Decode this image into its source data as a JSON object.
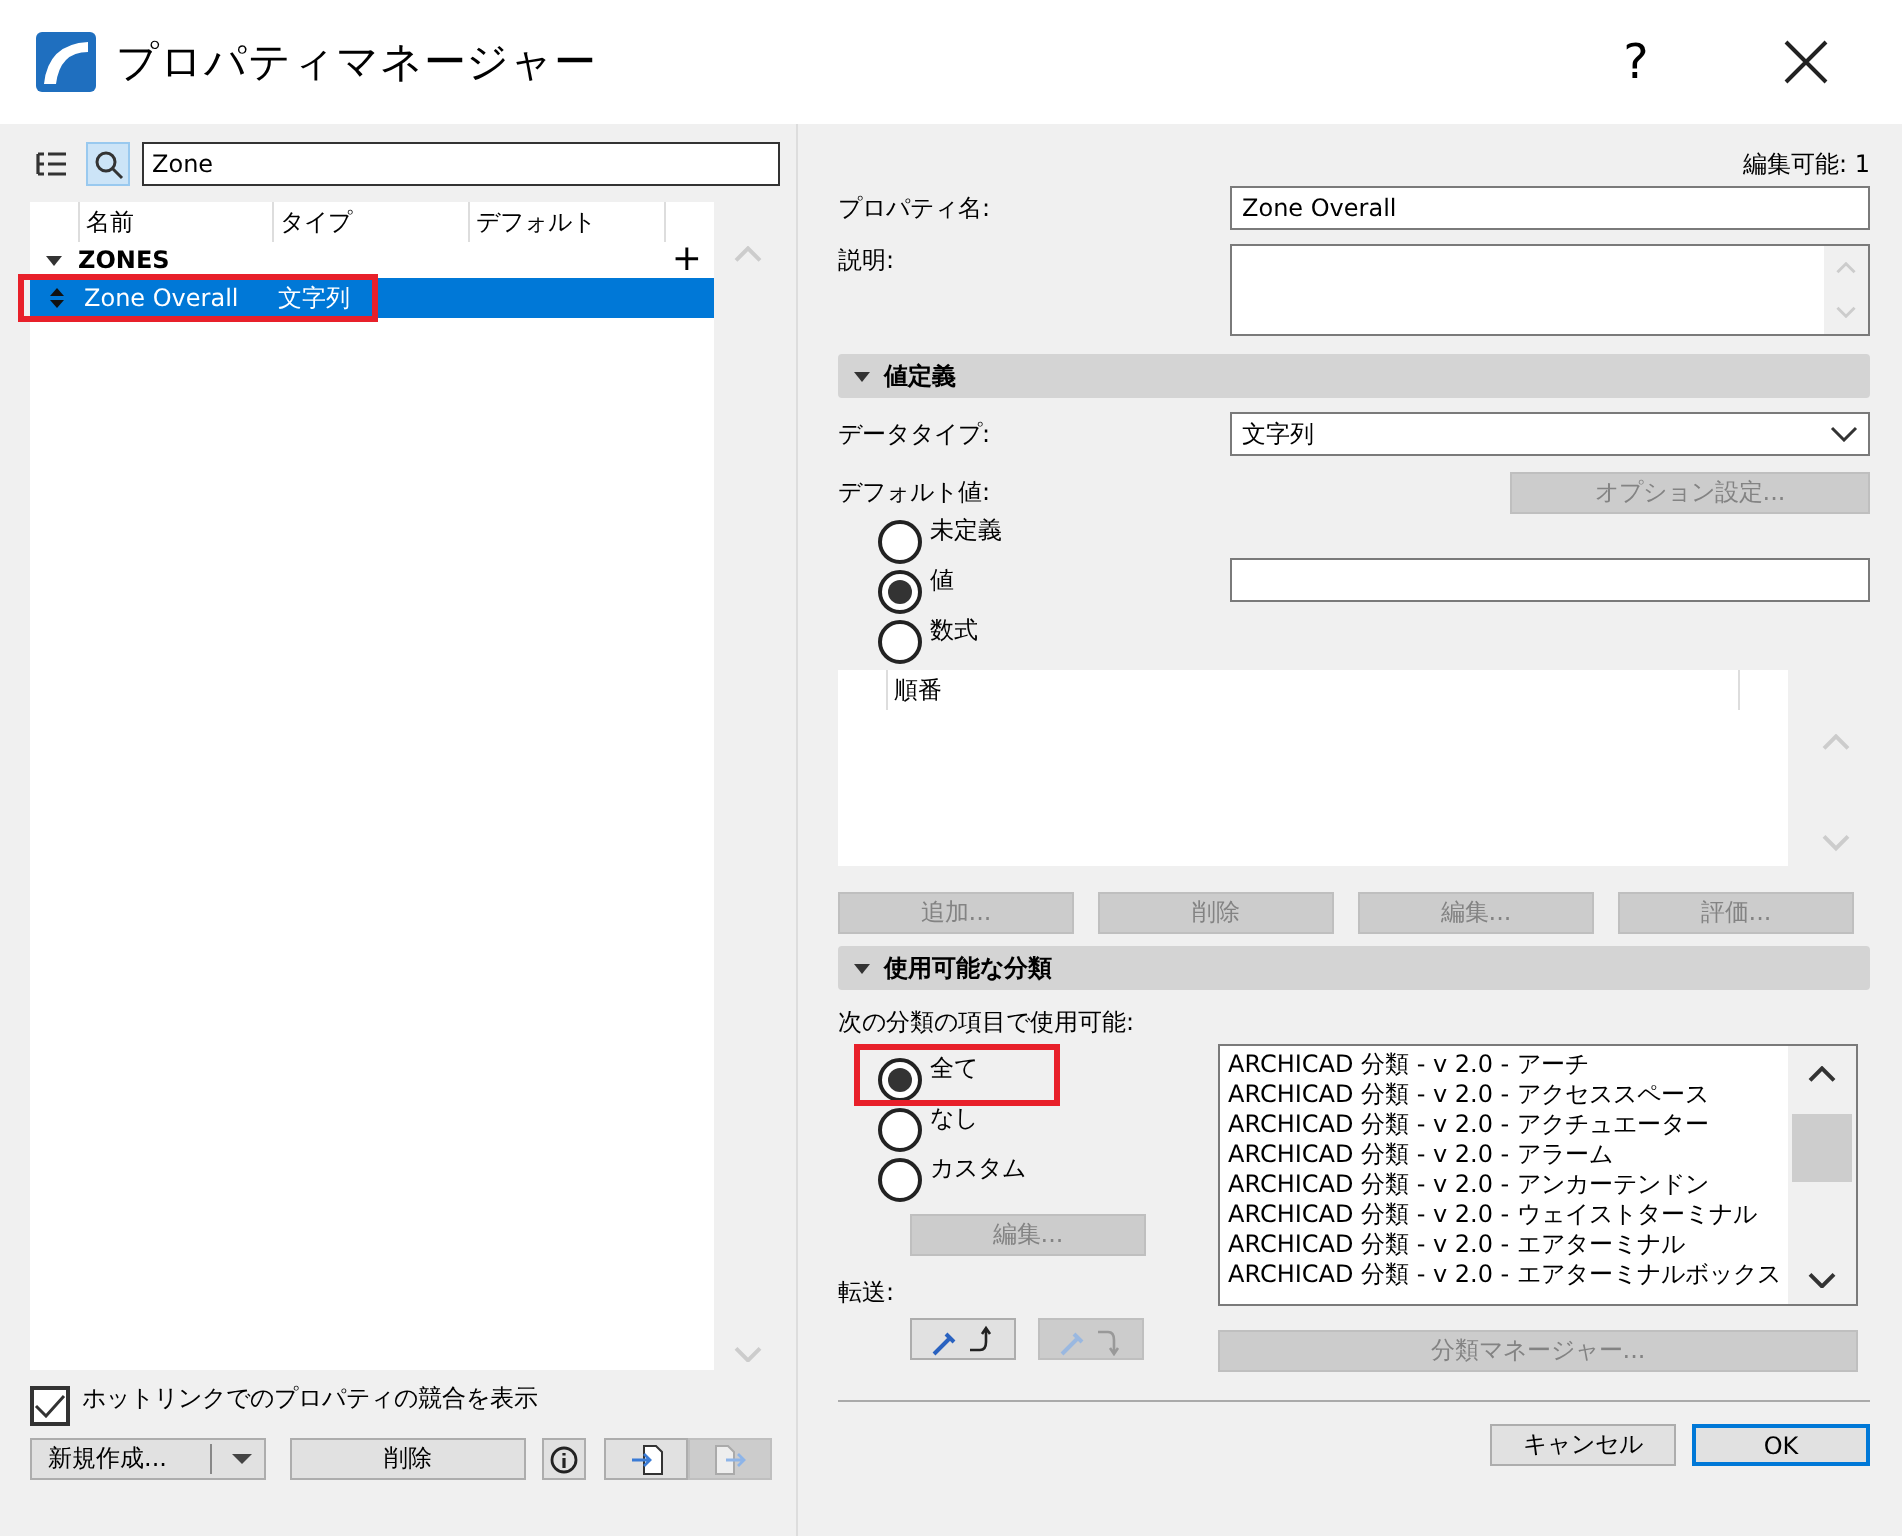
{
  "window": {
    "title": "プロパティマネージャー",
    "help": "?"
  },
  "left": {
    "search": {
      "value": "Zone"
    },
    "columns": [
      "名前",
      "タイプ",
      "デフォルト"
    ],
    "groups": [
      {
        "name": "ZONES",
        "expanded": true,
        "add": "+",
        "children": [
          {
            "name": "Zone Overall",
            "type": "文字列",
            "selected": true,
            "highlighted": true
          }
        ]
      }
    ],
    "hotlink": {
      "label": "ホットリンクでのプロパティの競合を表示",
      "checked": true
    },
    "new_button": "新規作成...",
    "delete_button": "削除"
  },
  "right": {
    "editable": "編集可能: 1",
    "name": {
      "label": "プロパティ名:",
      "value": "Zone Overall"
    },
    "description": {
      "label": "説明:"
    },
    "value_section": {
      "title": "値定義",
      "expanded": true
    },
    "data_type": {
      "label": "データタイプ:",
      "value": "文字列"
    },
    "default": {
      "label": "デフォルト値:",
      "options_button": "オプション設定...",
      "options_disabled": true
    },
    "default_options": [
      {
        "label": "未定義",
        "selected": false
      },
      {
        "label": "値",
        "selected": true
      },
      {
        "label": "数式",
        "selected": false
      }
    ],
    "expression_header": "順番",
    "expression_buttons": [
      {
        "label": "追加...",
        "disabled": true
      },
      {
        "label": "削除",
        "disabled": true
      },
      {
        "label": "編集...",
        "disabled": true
      },
      {
        "label": "評価...",
        "disabled": true
      }
    ],
    "class_section": {
      "title": "使用可能な分類",
      "expanded": true
    },
    "available_label": "次の分類の項目で使用可能:",
    "class_options": [
      {
        "label": "全て",
        "selected": true,
        "highlighted": true
      },
      {
        "label": "なし",
        "selected": false,
        "highlighted": false
      },
      {
        "label": "カスタム",
        "selected": false,
        "highlighted": false
      }
    ],
    "edit_button": {
      "label": "編集...",
      "disabled": true
    },
    "transfer_label": "転送:",
    "transfer_buttons": [
      {
        "kind": "pick",
        "disabled": false
      },
      {
        "kind": "inject",
        "disabled": true
      }
    ],
    "classes": [
      "ARCHICAD 分類 - v 2.0 - アーチ",
      "ARCHICAD 分類 - v 2.0 - アクセススペース",
      "ARCHICAD 分類 - v 2.0 - アクチュエーター",
      "ARCHICAD 分類 - v 2.0 - アラーム",
      "ARCHICAD 分類 - v 2.0 - アンカーテンドン",
      "ARCHICAD 分類 - v 2.0 - ウェイストターミナル",
      "ARCHICAD 分類 - v 2.0 - エアターミナル",
      "ARCHICAD 分類 - v 2.0 - エアターミナルボックス"
    ],
    "manager_button": {
      "label": "分類マネージャー...",
      "disabled": true
    },
    "cancel": "キャンセル",
    "ok": "OK"
  }
}
